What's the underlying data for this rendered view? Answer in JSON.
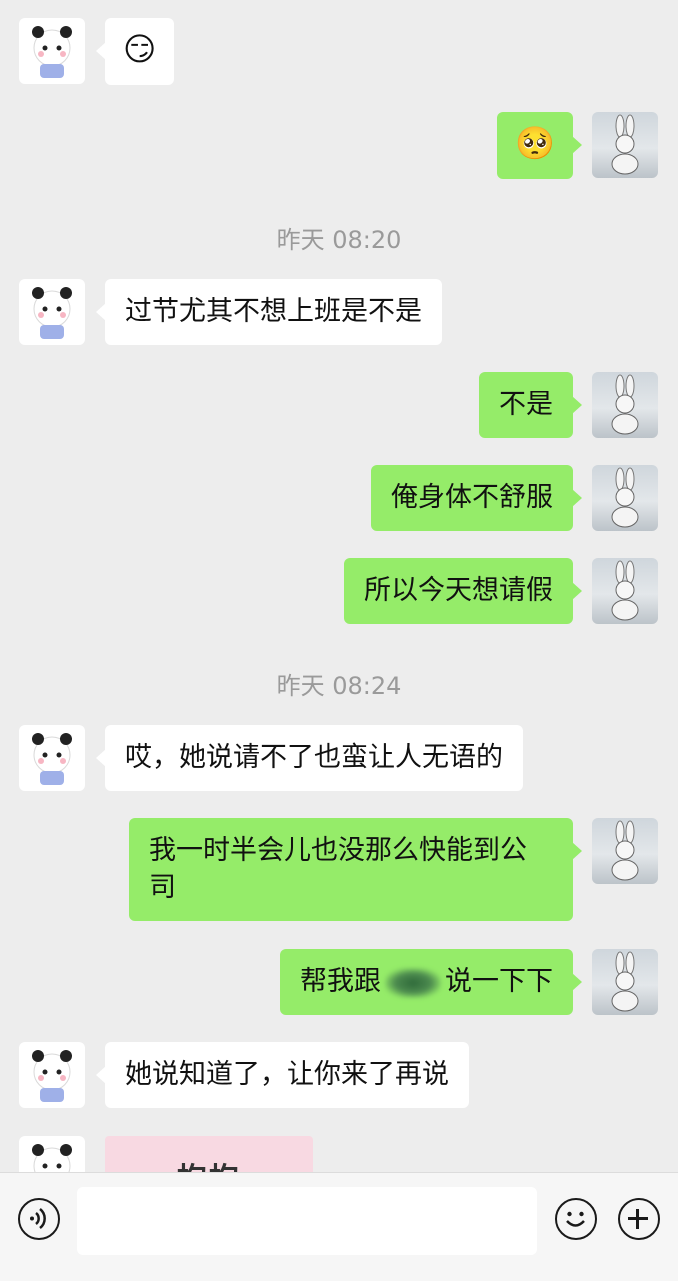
{
  "messages": [
    {
      "side": "in",
      "emoji": "😏"
    },
    {
      "side": "out",
      "emoji": "🥺"
    },
    {
      "timestamp": "昨天 08:20"
    },
    {
      "side": "in",
      "text": "过节尤其不想上班是不是"
    },
    {
      "side": "out",
      "text": "不是"
    },
    {
      "side": "out",
      "text": "俺身体不舒服"
    },
    {
      "side": "out",
      "text": "所以今天想请假"
    },
    {
      "timestamp": "昨天 08:24"
    },
    {
      "side": "in",
      "text": "哎，她说请不了也蛮让人无语的"
    },
    {
      "side": "out",
      "text": "我一时半会儿也没那么快能到公司"
    },
    {
      "side": "out",
      "text_before": "帮我跟",
      "text_after": "说一下下"
    },
    {
      "side": "in",
      "text": "她说知道了，让你来了再说"
    },
    {
      "side": "in",
      "sticker_text": "抱抱"
    }
  ],
  "input_bar": {
    "voice_icon": "voice-icon",
    "emoji_icon": "emoji-icon",
    "plus_icon": "plus-icon"
  },
  "colors": {
    "background": "#ededed",
    "incoming_bubble": "#ffffff",
    "outgoing_bubble": "#95ec69",
    "timestamp": "#9a9a9a"
  }
}
